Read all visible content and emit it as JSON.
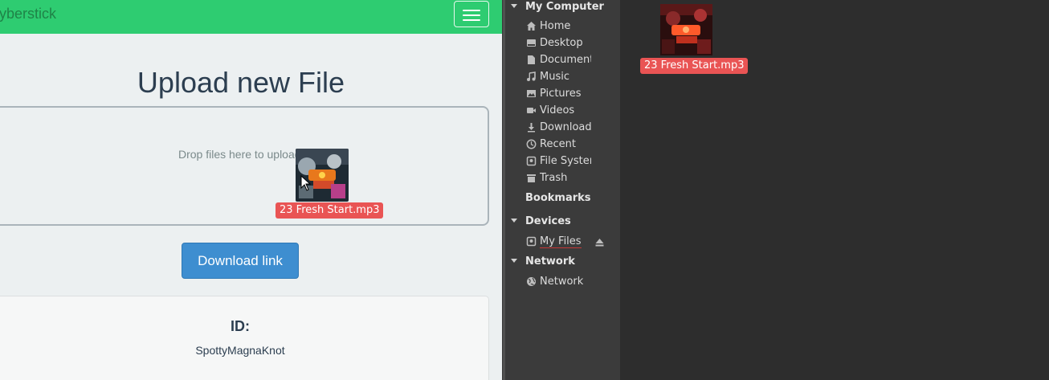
{
  "browser": {
    "navbar": {
      "brand": "Cyberstick"
    },
    "title": "Upload new File",
    "dropzone": {
      "message": "Drop files here to upload"
    },
    "download_button": "Download link",
    "info": {
      "id_label": "ID:",
      "id_value": "SpottyMagnaKnot"
    }
  },
  "drag": {
    "file_name": "23 Fresh Start.mp3"
  },
  "file_manager": {
    "sections": {
      "my_computer": "My Computer",
      "bookmarks": "Bookmarks",
      "devices": "Devices",
      "network": "Network"
    },
    "places": [
      {
        "label": "Home",
        "icon": "home-icon"
      },
      {
        "label": "Desktop",
        "icon": "desktop-icon"
      },
      {
        "label": "Documents",
        "icon": "document-icon"
      },
      {
        "label": "Music",
        "icon": "music-icon"
      },
      {
        "label": "Pictures",
        "icon": "picture-icon"
      },
      {
        "label": "Videos",
        "icon": "video-icon"
      },
      {
        "label": "Downloads",
        "icon": "download-icon"
      },
      {
        "label": "Recent",
        "icon": "clock-icon"
      },
      {
        "label": "File System",
        "icon": "drive-icon"
      },
      {
        "label": "Trash",
        "icon": "trash-icon"
      }
    ],
    "devices": [
      {
        "label": "My Files",
        "icon": "drive-icon"
      }
    ],
    "network": [
      {
        "label": "Network",
        "icon": "globe-icon"
      }
    ],
    "files": [
      {
        "name": "23 Fresh Start.mp3"
      }
    ]
  }
}
